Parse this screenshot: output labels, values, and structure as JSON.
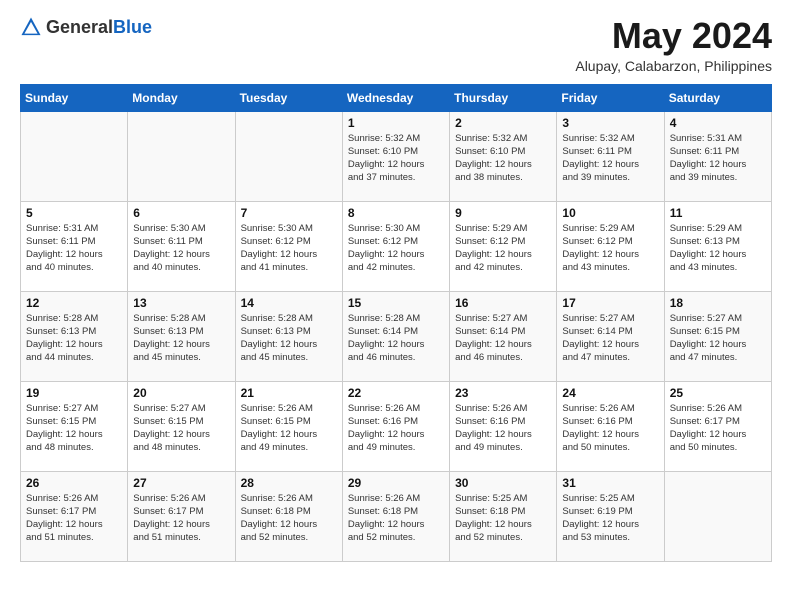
{
  "header": {
    "logo_general": "General",
    "logo_blue": "Blue",
    "month_year": "May 2024",
    "location": "Alupay, Calabarzon, Philippines"
  },
  "days_of_week": [
    "Sunday",
    "Monday",
    "Tuesday",
    "Wednesday",
    "Thursday",
    "Friday",
    "Saturday"
  ],
  "weeks": [
    {
      "cells": [
        {
          "day": "",
          "info": ""
        },
        {
          "day": "",
          "info": ""
        },
        {
          "day": "",
          "info": ""
        },
        {
          "day": "1",
          "info": "Sunrise: 5:32 AM\nSunset: 6:10 PM\nDaylight: 12 hours\nand 37 minutes."
        },
        {
          "day": "2",
          "info": "Sunrise: 5:32 AM\nSunset: 6:10 PM\nDaylight: 12 hours\nand 38 minutes."
        },
        {
          "day": "3",
          "info": "Sunrise: 5:32 AM\nSunset: 6:11 PM\nDaylight: 12 hours\nand 39 minutes."
        },
        {
          "day": "4",
          "info": "Sunrise: 5:31 AM\nSunset: 6:11 PM\nDaylight: 12 hours\nand 39 minutes."
        }
      ]
    },
    {
      "cells": [
        {
          "day": "5",
          "info": "Sunrise: 5:31 AM\nSunset: 6:11 PM\nDaylight: 12 hours\nand 40 minutes."
        },
        {
          "day": "6",
          "info": "Sunrise: 5:30 AM\nSunset: 6:11 PM\nDaylight: 12 hours\nand 40 minutes."
        },
        {
          "day": "7",
          "info": "Sunrise: 5:30 AM\nSunset: 6:12 PM\nDaylight: 12 hours\nand 41 minutes."
        },
        {
          "day": "8",
          "info": "Sunrise: 5:30 AM\nSunset: 6:12 PM\nDaylight: 12 hours\nand 42 minutes."
        },
        {
          "day": "9",
          "info": "Sunrise: 5:29 AM\nSunset: 6:12 PM\nDaylight: 12 hours\nand 42 minutes."
        },
        {
          "day": "10",
          "info": "Sunrise: 5:29 AM\nSunset: 6:12 PM\nDaylight: 12 hours\nand 43 minutes."
        },
        {
          "day": "11",
          "info": "Sunrise: 5:29 AM\nSunset: 6:13 PM\nDaylight: 12 hours\nand 43 minutes."
        }
      ]
    },
    {
      "cells": [
        {
          "day": "12",
          "info": "Sunrise: 5:28 AM\nSunset: 6:13 PM\nDaylight: 12 hours\nand 44 minutes."
        },
        {
          "day": "13",
          "info": "Sunrise: 5:28 AM\nSunset: 6:13 PM\nDaylight: 12 hours\nand 45 minutes."
        },
        {
          "day": "14",
          "info": "Sunrise: 5:28 AM\nSunset: 6:13 PM\nDaylight: 12 hours\nand 45 minutes."
        },
        {
          "day": "15",
          "info": "Sunrise: 5:28 AM\nSunset: 6:14 PM\nDaylight: 12 hours\nand 46 minutes."
        },
        {
          "day": "16",
          "info": "Sunrise: 5:27 AM\nSunset: 6:14 PM\nDaylight: 12 hours\nand 46 minutes."
        },
        {
          "day": "17",
          "info": "Sunrise: 5:27 AM\nSunset: 6:14 PM\nDaylight: 12 hours\nand 47 minutes."
        },
        {
          "day": "18",
          "info": "Sunrise: 5:27 AM\nSunset: 6:15 PM\nDaylight: 12 hours\nand 47 minutes."
        }
      ]
    },
    {
      "cells": [
        {
          "day": "19",
          "info": "Sunrise: 5:27 AM\nSunset: 6:15 PM\nDaylight: 12 hours\nand 48 minutes."
        },
        {
          "day": "20",
          "info": "Sunrise: 5:27 AM\nSunset: 6:15 PM\nDaylight: 12 hours\nand 48 minutes."
        },
        {
          "day": "21",
          "info": "Sunrise: 5:26 AM\nSunset: 6:15 PM\nDaylight: 12 hours\nand 49 minutes."
        },
        {
          "day": "22",
          "info": "Sunrise: 5:26 AM\nSunset: 6:16 PM\nDaylight: 12 hours\nand 49 minutes."
        },
        {
          "day": "23",
          "info": "Sunrise: 5:26 AM\nSunset: 6:16 PM\nDaylight: 12 hours\nand 49 minutes."
        },
        {
          "day": "24",
          "info": "Sunrise: 5:26 AM\nSunset: 6:16 PM\nDaylight: 12 hours\nand 50 minutes."
        },
        {
          "day": "25",
          "info": "Sunrise: 5:26 AM\nSunset: 6:17 PM\nDaylight: 12 hours\nand 50 minutes."
        }
      ]
    },
    {
      "cells": [
        {
          "day": "26",
          "info": "Sunrise: 5:26 AM\nSunset: 6:17 PM\nDaylight: 12 hours\nand 51 minutes."
        },
        {
          "day": "27",
          "info": "Sunrise: 5:26 AM\nSunset: 6:17 PM\nDaylight: 12 hours\nand 51 minutes."
        },
        {
          "day": "28",
          "info": "Sunrise: 5:26 AM\nSunset: 6:18 PM\nDaylight: 12 hours\nand 52 minutes."
        },
        {
          "day": "29",
          "info": "Sunrise: 5:26 AM\nSunset: 6:18 PM\nDaylight: 12 hours\nand 52 minutes."
        },
        {
          "day": "30",
          "info": "Sunrise: 5:25 AM\nSunset: 6:18 PM\nDaylight: 12 hours\nand 52 minutes."
        },
        {
          "day": "31",
          "info": "Sunrise: 5:25 AM\nSunset: 6:19 PM\nDaylight: 12 hours\nand 53 minutes."
        },
        {
          "day": "",
          "info": ""
        }
      ]
    }
  ]
}
